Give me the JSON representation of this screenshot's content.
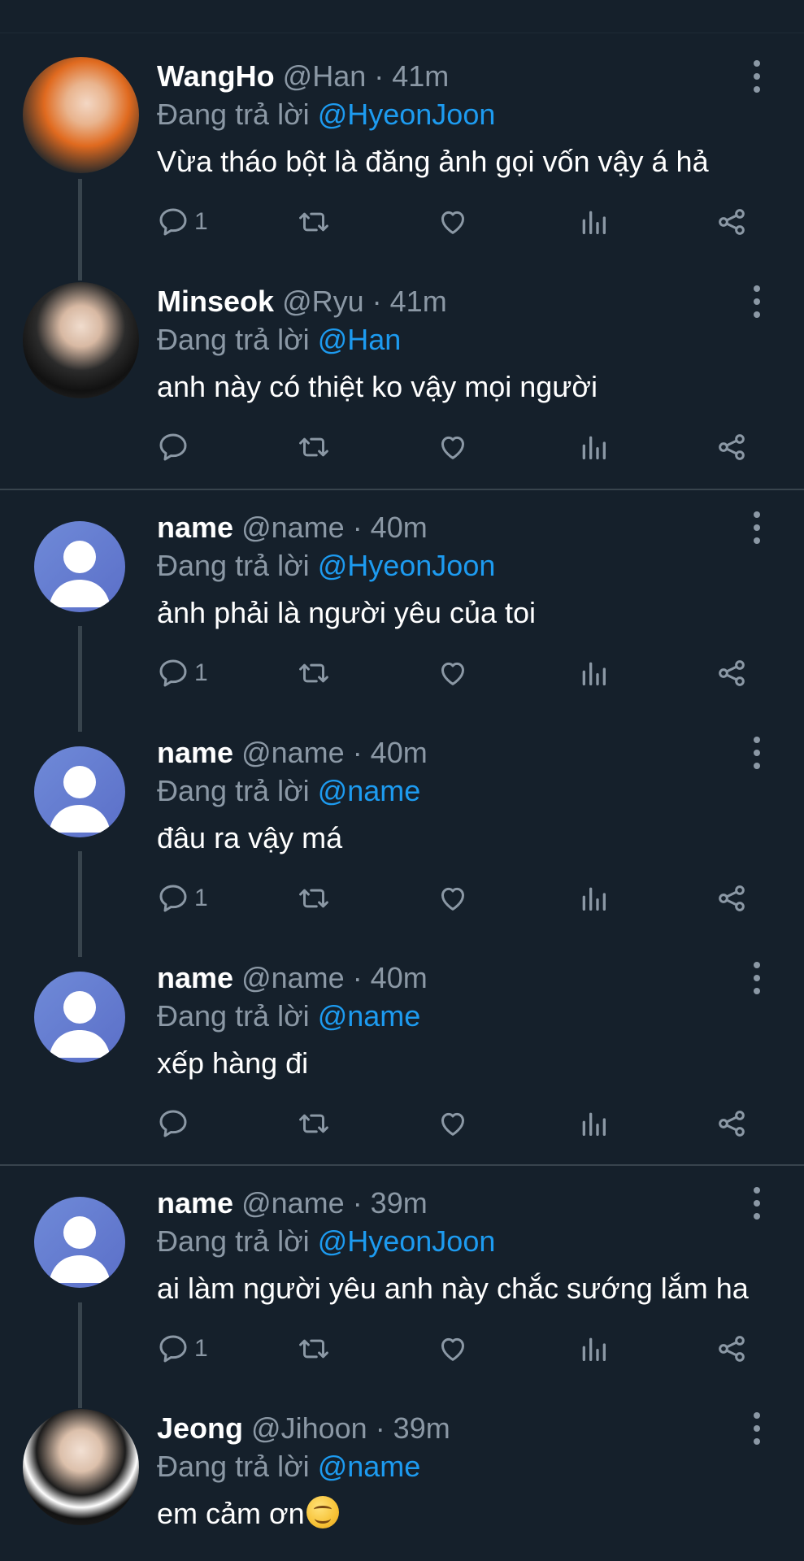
{
  "tweets": [
    {
      "name": "WangHo",
      "handle": "@Han",
      "time": "· 41m",
      "reply_prefix": "Đang trả lời",
      "reply_to": "@HyeonJoon",
      "text": "Vừa tháo bột là đăng ảnh gọi vốn vậy á hả",
      "reply_count": "1",
      "avatar": "photo-orange"
    },
    {
      "name": "Minseok",
      "handle": "@Ryu",
      "time": "· 41m",
      "reply_prefix": "Đang trả lời",
      "reply_to": "@Han",
      "text": "anh này có thiệt ko vậy mọi người",
      "reply_count": "",
      "avatar": "photo-dark"
    },
    {
      "name": "name",
      "handle": "@name",
      "time": "· 40m",
      "reply_prefix": "Đang trả lời",
      "reply_to": "@HyeonJoon",
      "text": "ảnh phải là người yêu của toi",
      "reply_count": "1",
      "avatar": "default"
    },
    {
      "name": "name",
      "handle": "@name",
      "time": "· 40m",
      "reply_prefix": "Đang trả lời",
      "reply_to": "@name",
      "text": "đâu ra vậy má",
      "reply_count": "1",
      "avatar": "default"
    },
    {
      "name": "name",
      "handle": "@name",
      "time": "· 40m",
      "reply_prefix": "Đang trả lời",
      "reply_to": "@name",
      "text": "xếp hàng đi",
      "reply_count": "",
      "avatar": "default"
    },
    {
      "name": "name",
      "handle": "@name",
      "time": "· 39m",
      "reply_prefix": "Đang trả lời",
      "reply_to": "@HyeonJoon",
      "text": "ai làm người yêu anh này chắc sướng lắm ha",
      "reply_count": "1",
      "avatar": "default"
    },
    {
      "name": "Jeong",
      "handle": "@Jihoon",
      "time": "· 39m",
      "reply_prefix": "Đang trả lời",
      "reply_to": "@name",
      "text": "em cảm ơn",
      "reply_count": "",
      "avatar": "photo-uniform",
      "emoji": "smiling-face-emoji"
    }
  ],
  "icons": {
    "reply": "reply-icon",
    "retweet": "retweet-icon",
    "like": "like-icon",
    "views": "views-icon",
    "share": "share-icon",
    "more": "more-options-icon"
  },
  "colors": {
    "background": "#15202b",
    "mention": "#1d9bf0",
    "secondary_text": "#8b98a5",
    "divider": "#38444d"
  }
}
